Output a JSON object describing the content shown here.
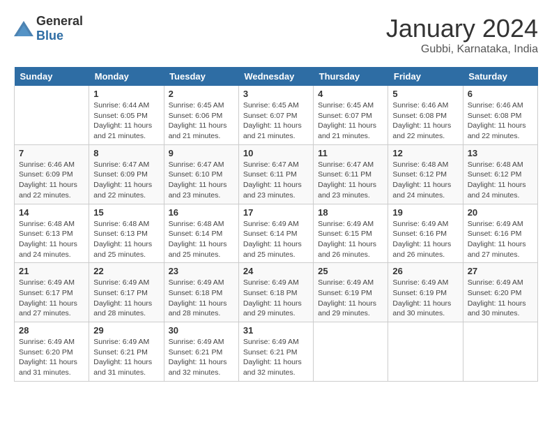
{
  "header": {
    "logo": {
      "general": "General",
      "blue": "Blue"
    },
    "title": "January 2024",
    "location": "Gubbi, Karnataka, India"
  },
  "weekdays": [
    "Sunday",
    "Monday",
    "Tuesday",
    "Wednesday",
    "Thursday",
    "Friday",
    "Saturday"
  ],
  "weeks": [
    [
      {
        "day": "",
        "sunrise": "",
        "sunset": "",
        "daylight": ""
      },
      {
        "day": "1",
        "sunrise": "Sunrise: 6:44 AM",
        "sunset": "Sunset: 6:05 PM",
        "daylight": "Daylight: 11 hours and 21 minutes."
      },
      {
        "day": "2",
        "sunrise": "Sunrise: 6:45 AM",
        "sunset": "Sunset: 6:06 PM",
        "daylight": "Daylight: 11 hours and 21 minutes."
      },
      {
        "day": "3",
        "sunrise": "Sunrise: 6:45 AM",
        "sunset": "Sunset: 6:07 PM",
        "daylight": "Daylight: 11 hours and 21 minutes."
      },
      {
        "day": "4",
        "sunrise": "Sunrise: 6:45 AM",
        "sunset": "Sunset: 6:07 PM",
        "daylight": "Daylight: 11 hours and 21 minutes."
      },
      {
        "day": "5",
        "sunrise": "Sunrise: 6:46 AM",
        "sunset": "Sunset: 6:08 PM",
        "daylight": "Daylight: 11 hours and 22 minutes."
      },
      {
        "day": "6",
        "sunrise": "Sunrise: 6:46 AM",
        "sunset": "Sunset: 6:08 PM",
        "daylight": "Daylight: 11 hours and 22 minutes."
      }
    ],
    [
      {
        "day": "7",
        "sunrise": "Sunrise: 6:46 AM",
        "sunset": "Sunset: 6:09 PM",
        "daylight": "Daylight: 11 hours and 22 minutes."
      },
      {
        "day": "8",
        "sunrise": "Sunrise: 6:47 AM",
        "sunset": "Sunset: 6:09 PM",
        "daylight": "Daylight: 11 hours and 22 minutes."
      },
      {
        "day": "9",
        "sunrise": "Sunrise: 6:47 AM",
        "sunset": "Sunset: 6:10 PM",
        "daylight": "Daylight: 11 hours and 23 minutes."
      },
      {
        "day": "10",
        "sunrise": "Sunrise: 6:47 AM",
        "sunset": "Sunset: 6:11 PM",
        "daylight": "Daylight: 11 hours and 23 minutes."
      },
      {
        "day": "11",
        "sunrise": "Sunrise: 6:47 AM",
        "sunset": "Sunset: 6:11 PM",
        "daylight": "Daylight: 11 hours and 23 minutes."
      },
      {
        "day": "12",
        "sunrise": "Sunrise: 6:48 AM",
        "sunset": "Sunset: 6:12 PM",
        "daylight": "Daylight: 11 hours and 24 minutes."
      },
      {
        "day": "13",
        "sunrise": "Sunrise: 6:48 AM",
        "sunset": "Sunset: 6:12 PM",
        "daylight": "Daylight: 11 hours and 24 minutes."
      }
    ],
    [
      {
        "day": "14",
        "sunrise": "Sunrise: 6:48 AM",
        "sunset": "Sunset: 6:13 PM",
        "daylight": "Daylight: 11 hours and 24 minutes."
      },
      {
        "day": "15",
        "sunrise": "Sunrise: 6:48 AM",
        "sunset": "Sunset: 6:13 PM",
        "daylight": "Daylight: 11 hours and 25 minutes."
      },
      {
        "day": "16",
        "sunrise": "Sunrise: 6:48 AM",
        "sunset": "Sunset: 6:14 PM",
        "daylight": "Daylight: 11 hours and 25 minutes."
      },
      {
        "day": "17",
        "sunrise": "Sunrise: 6:49 AM",
        "sunset": "Sunset: 6:14 PM",
        "daylight": "Daylight: 11 hours and 25 minutes."
      },
      {
        "day": "18",
        "sunrise": "Sunrise: 6:49 AM",
        "sunset": "Sunset: 6:15 PM",
        "daylight": "Daylight: 11 hours and 26 minutes."
      },
      {
        "day": "19",
        "sunrise": "Sunrise: 6:49 AM",
        "sunset": "Sunset: 6:16 PM",
        "daylight": "Daylight: 11 hours and 26 minutes."
      },
      {
        "day": "20",
        "sunrise": "Sunrise: 6:49 AM",
        "sunset": "Sunset: 6:16 PM",
        "daylight": "Daylight: 11 hours and 27 minutes."
      }
    ],
    [
      {
        "day": "21",
        "sunrise": "Sunrise: 6:49 AM",
        "sunset": "Sunset: 6:17 PM",
        "daylight": "Daylight: 11 hours and 27 minutes."
      },
      {
        "day": "22",
        "sunrise": "Sunrise: 6:49 AM",
        "sunset": "Sunset: 6:17 PM",
        "daylight": "Daylight: 11 hours and 28 minutes."
      },
      {
        "day": "23",
        "sunrise": "Sunrise: 6:49 AM",
        "sunset": "Sunset: 6:18 PM",
        "daylight": "Daylight: 11 hours and 28 minutes."
      },
      {
        "day": "24",
        "sunrise": "Sunrise: 6:49 AM",
        "sunset": "Sunset: 6:18 PM",
        "daylight": "Daylight: 11 hours and 29 minutes."
      },
      {
        "day": "25",
        "sunrise": "Sunrise: 6:49 AM",
        "sunset": "Sunset: 6:19 PM",
        "daylight": "Daylight: 11 hours and 29 minutes."
      },
      {
        "day": "26",
        "sunrise": "Sunrise: 6:49 AM",
        "sunset": "Sunset: 6:19 PM",
        "daylight": "Daylight: 11 hours and 30 minutes."
      },
      {
        "day": "27",
        "sunrise": "Sunrise: 6:49 AM",
        "sunset": "Sunset: 6:20 PM",
        "daylight": "Daylight: 11 hours and 30 minutes."
      }
    ],
    [
      {
        "day": "28",
        "sunrise": "Sunrise: 6:49 AM",
        "sunset": "Sunset: 6:20 PM",
        "daylight": "Daylight: 11 hours and 31 minutes."
      },
      {
        "day": "29",
        "sunrise": "Sunrise: 6:49 AM",
        "sunset": "Sunset: 6:21 PM",
        "daylight": "Daylight: 11 hours and 31 minutes."
      },
      {
        "day": "30",
        "sunrise": "Sunrise: 6:49 AM",
        "sunset": "Sunset: 6:21 PM",
        "daylight": "Daylight: 11 hours and 32 minutes."
      },
      {
        "day": "31",
        "sunrise": "Sunrise: 6:49 AM",
        "sunset": "Sunset: 6:21 PM",
        "daylight": "Daylight: 11 hours and 32 minutes."
      },
      {
        "day": "",
        "sunrise": "",
        "sunset": "",
        "daylight": ""
      },
      {
        "day": "",
        "sunrise": "",
        "sunset": "",
        "daylight": ""
      },
      {
        "day": "",
        "sunrise": "",
        "sunset": "",
        "daylight": ""
      }
    ]
  ]
}
